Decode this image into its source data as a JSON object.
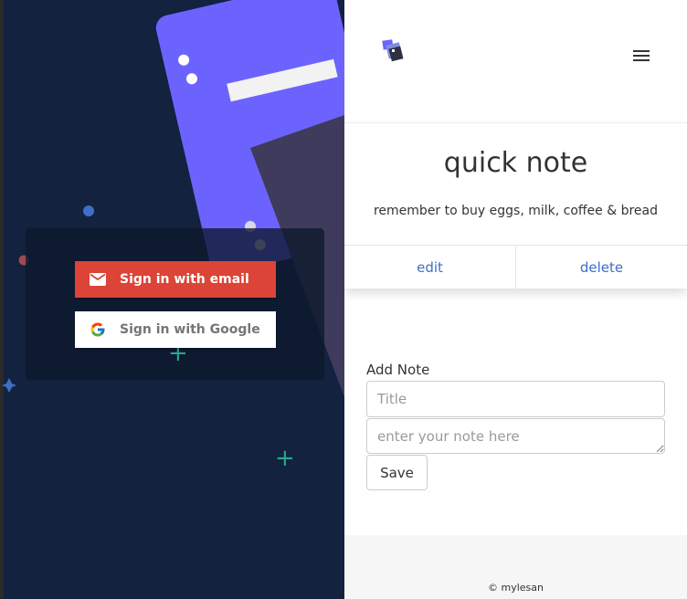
{
  "auth": {
    "email_button_label": "Sign in with email",
    "google_button_label": "Sign in with Google"
  },
  "note": {
    "title": "quick note",
    "body": "remember to buy eggs, milk, coffee & bread",
    "edit_label": "edit",
    "delete_label": "delete"
  },
  "form": {
    "heading": "Add Note",
    "title_placeholder": "Title",
    "note_placeholder": "enter your note here",
    "save_label": "Save"
  },
  "footer": {
    "text": "© mylesan"
  },
  "icons": {
    "email": "mail-icon",
    "google": "google-g-icon",
    "menu": "hamburger-menu-icon",
    "logo": "app-logo-icon"
  },
  "colors": {
    "left_background": "#12223f",
    "illustration_purple": "#6c63ff",
    "email_button": "#db4437",
    "link_blue": "#3b6fc8",
    "plus_green": "#2aa58a"
  }
}
